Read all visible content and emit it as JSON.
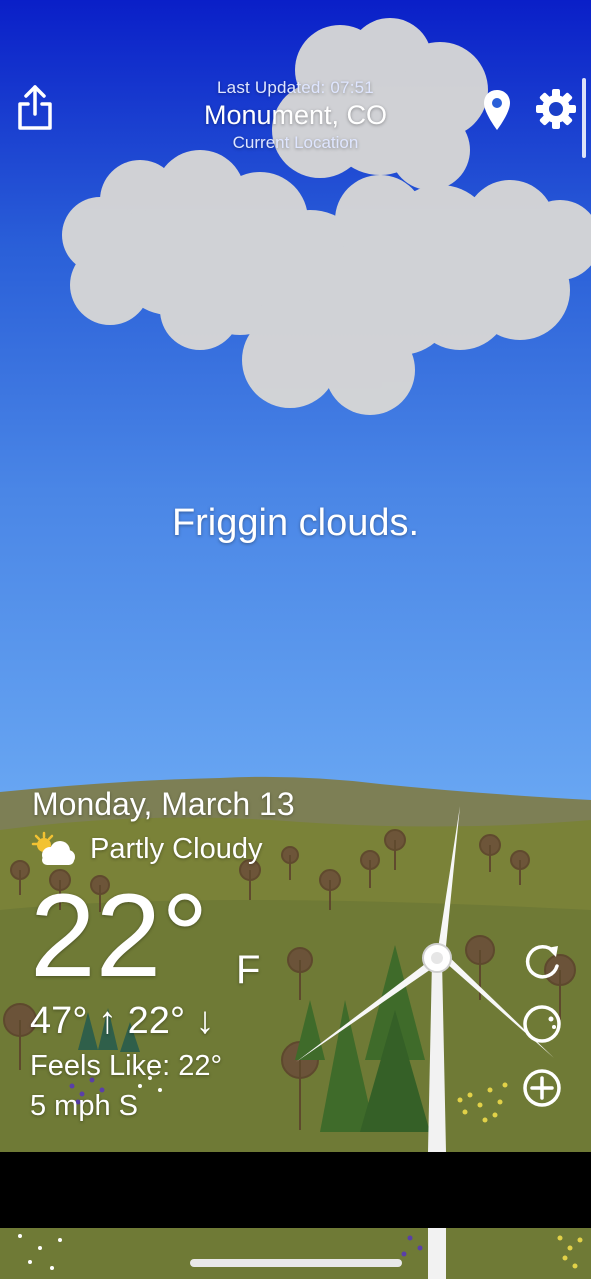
{
  "header": {
    "last_updated": "Last Updated: 07:51",
    "location": "Monument, CO",
    "current_location": "Current Location"
  },
  "icons": {
    "share": "share-icon",
    "location": "location-pin-icon",
    "settings": "gear-icon",
    "condition": "partly-cloudy-icon",
    "refresh": "refresh-icon",
    "moon": "moon-phase-icon",
    "add": "add-circle-icon"
  },
  "quip": "Friggin clouds.",
  "weather": {
    "date": "Monday, March 13",
    "condition": "Partly Cloudy",
    "temperature": "22°",
    "unit": "F",
    "hilo": "47° ↑  22° ↓",
    "feels_like": "Feels Like: 22°",
    "wind": "5 mph S"
  },
  "colors": {
    "sky_top": "#0a1fc8",
    "sky_bottom": "#6aa8f3",
    "hill": "#7a7f4a",
    "grass": "#6f7a36",
    "cloud": "#d4d4d4"
  }
}
